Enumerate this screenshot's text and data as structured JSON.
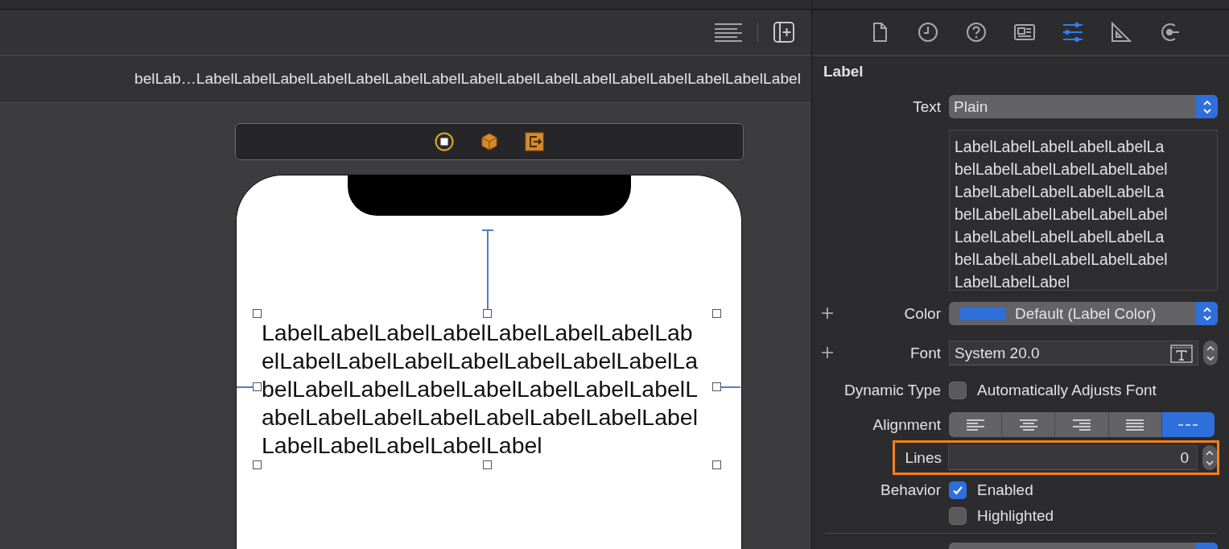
{
  "editor": {
    "breadcrumb": "belLab…LabelLabelLabelLabelLabelLabelLabelLabelLabelLabelLabelLabelLabelLabelLabelLabel",
    "canvas_label": {
      "lines": [
        "LabelLabelLabelLabelLabelLabelLabelLab",
        "elLabelLabelLabelLabelLabelLabelLabelLa",
        "belLabelLabelLabelLabelLabelLabelLabelL",
        "abelLabelLabelLabelLabelLabelLabelLabel",
        "LabelLabelLabelLabelLabel"
      ]
    }
  },
  "inspector": {
    "tabs": [
      {
        "kind": "file",
        "selected": false
      },
      {
        "kind": "history",
        "selected": false
      },
      {
        "kind": "help",
        "selected": false
      },
      {
        "kind": "identity",
        "selected": false
      },
      {
        "kind": "attributes",
        "selected": true
      },
      {
        "kind": "size",
        "selected": false
      },
      {
        "kind": "connections",
        "selected": false
      }
    ],
    "section_title": "Label",
    "text_type": {
      "label": "Text",
      "value": "Plain"
    },
    "text_value": {
      "lines": [
        "LabelLabelLabelLabelLabelLa",
        "belLabelLabelLabelLabelLabel",
        "LabelLabelLabelLabelLabelLa",
        "belLabelLabelLabelLabelLabel",
        "LabelLabelLabelLabelLabelLa",
        "belLabelLabelLabelLabelLabel",
        "LabelLabelLabel"
      ]
    },
    "color": {
      "label": "Color",
      "value": "Default (Label Color)",
      "color": "#2f6fdc"
    },
    "font": {
      "label": "Font",
      "value": "System 20.0"
    },
    "dynamic_type": {
      "label": "Dynamic Type",
      "option": "Automatically Adjusts Font",
      "checked": false
    },
    "alignment": {
      "label": "Alignment",
      "options": [
        {
          "kind": "left",
          "selected": false
        },
        {
          "kind": "center",
          "selected": false
        },
        {
          "kind": "right",
          "selected": false
        },
        {
          "kind": "justified",
          "selected": false
        },
        {
          "kind": "natural",
          "selected": true
        }
      ]
    },
    "lines": {
      "label": "Lines",
      "value": "0",
      "outlined": true
    },
    "behavior": {
      "label": "Behavior",
      "options": [
        {
          "label": "Enabled",
          "checked": true
        },
        {
          "label": "Highlighted",
          "checked": false
        }
      ]
    }
  }
}
